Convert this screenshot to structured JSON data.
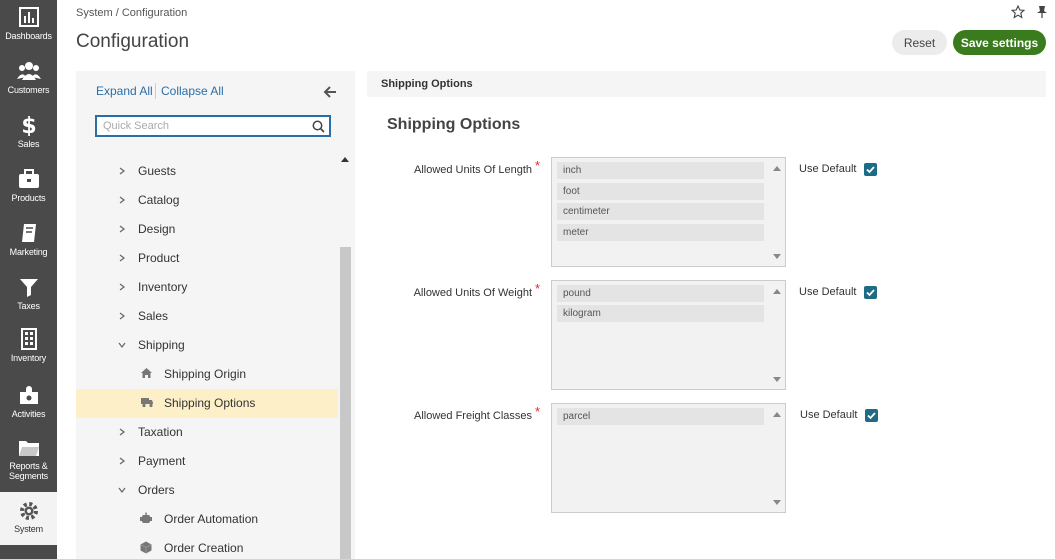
{
  "nav": [
    {
      "label": "Dashboards",
      "icon": "dashboards-icon"
    },
    {
      "label": "Customers",
      "icon": "customers-icon"
    },
    {
      "label": "Sales",
      "icon": "dollar-icon"
    },
    {
      "label": "Products",
      "icon": "products-icon"
    },
    {
      "label": "Marketing",
      "icon": "marketing-icon"
    },
    {
      "label": "Taxes",
      "icon": "funnel-icon"
    },
    {
      "label": "Inventory",
      "icon": "inventory-icon"
    },
    {
      "label": "Activities",
      "icon": "puzzle-icon"
    },
    {
      "label": "Reports &",
      "label2": "Segments",
      "icon": "folder-icon"
    },
    {
      "label": "System",
      "icon": "gear-icon"
    }
  ],
  "header": {
    "breadcrumb": "System / Configuration",
    "title": "Configuration",
    "reset_label": "Reset",
    "save_label": "Save settings"
  },
  "tree": {
    "expand_all": "Expand All",
    "collapse_all": "Collapse All",
    "search_placeholder": "Quick Search",
    "items": [
      {
        "label": "Guests"
      },
      {
        "label": "Catalog"
      },
      {
        "label": "Design"
      },
      {
        "label": "Product"
      },
      {
        "label": "Inventory"
      },
      {
        "label": "Sales"
      },
      {
        "label": "Shipping"
      },
      {
        "label": "Shipping Origin"
      },
      {
        "label": "Shipping Options"
      },
      {
        "label": "Taxation"
      },
      {
        "label": "Payment"
      },
      {
        "label": "Orders"
      },
      {
        "label": "Order Automation"
      },
      {
        "label": "Order Creation"
      }
    ]
  },
  "content": {
    "section_bar": "Shipping Options",
    "section_title": "Shipping Options",
    "use_default": "Use Default",
    "fields": [
      {
        "label": "Allowed Units Of Length",
        "options": [
          "inch",
          "foot",
          "centimeter",
          "meter"
        ]
      },
      {
        "label": "Allowed Units Of Weight",
        "options": [
          "pound",
          "kilogram"
        ]
      },
      {
        "label": "Allowed Freight Classes",
        "options": [
          "parcel"
        ]
      }
    ]
  },
  "colors": {
    "nav_bg": "#4a4a4a",
    "save_bg": "#3a7c1d",
    "link": "#2a6ea8",
    "selected_row": "#fdf0c8",
    "checkbox": "#1d6b86",
    "required": "#e02b27"
  }
}
